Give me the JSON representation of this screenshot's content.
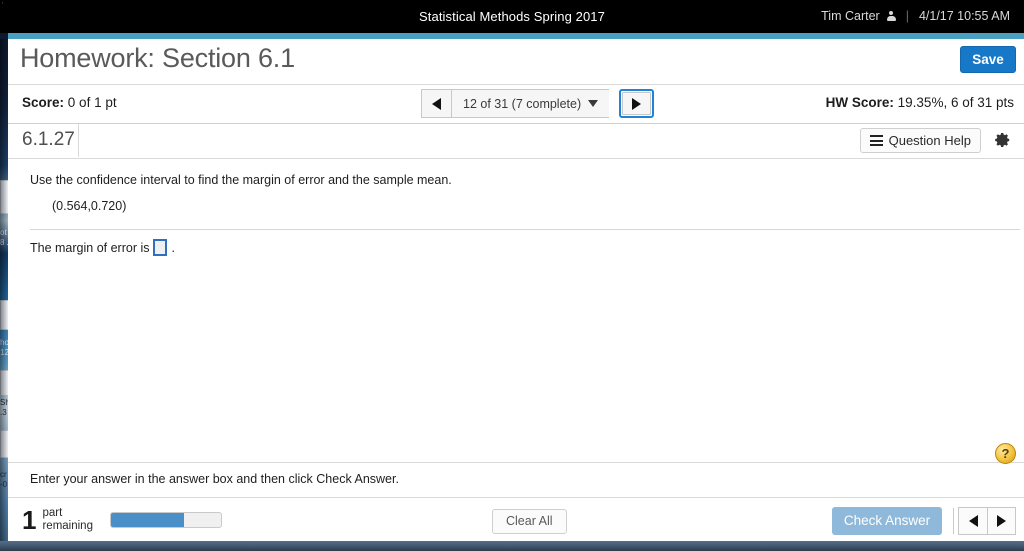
{
  "topbar": {
    "course_title": "Statistical Methods Spring 2017",
    "user_name": "Tim Carter",
    "user_icon": "person-icon",
    "divider": "|",
    "timestamp": "4/1/17 10:55 AM"
  },
  "header": {
    "assignment_title": "Homework: Section 6.1",
    "save_label": "Save"
  },
  "score_bar": {
    "score_label": "Score:",
    "score_value": "0 of 1 pt",
    "hw_score_label": "HW Score:",
    "hw_score_value": "19.35%, 6 of 31 pts",
    "pager": {
      "prev_icon": "triangle-left-icon",
      "current": "12 of 31 (7 complete)",
      "dropdown_icon": "chevron-down-icon",
      "next_icon": "triangle-right-icon"
    }
  },
  "question_header": {
    "question_id": "6.1.27",
    "question_help_label": "Question Help",
    "list_icon": "list-icon",
    "gear_icon": "gear-icon"
  },
  "question": {
    "prompt": "Use the confidence interval to find the margin of error and the sample mean.",
    "interval": "(0.564,0.720)",
    "answer_prompt_before": "The margin of error is",
    "answer_value": "",
    "answer_prompt_after": "."
  },
  "instruction": {
    "text": "Enter your answer in the answer box and then click Check Answer.",
    "help_badge": "?"
  },
  "footer": {
    "parts_count": "1",
    "parts_label_line1": "part",
    "parts_label_line2": "remaining",
    "progress_percent": 66,
    "clear_all_label": "Clear All",
    "check_answer_label": "Check Answer",
    "prev_icon": "triangle-left-icon",
    "next_icon": "triangle-right-icon"
  },
  "colors": {
    "accent_blue": "#1878c8",
    "teal_strip": "#4aa0c0",
    "focus_blue": "#1f84d6",
    "disabled_blue": "#8fb9da",
    "progress_blue": "#4a8fc8",
    "help_gold": "#f3c33f",
    "topbar_black": "#000000"
  },
  "background_window": {
    "snippets": [
      "ot",
      "8 .",
      "ho",
      "12",
      "Sh",
      ".3",
      "cr",
      "-0"
    ]
  }
}
